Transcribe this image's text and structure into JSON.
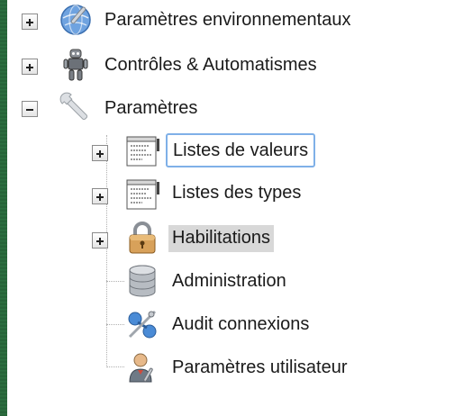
{
  "tree": {
    "root_items": [
      {
        "label": "Paramètres environnementaux",
        "expander": "+",
        "icon": "globe-wrench-icon"
      },
      {
        "label": "Contrôles & Automatismes",
        "expander": "+",
        "icon": "robot-icon"
      },
      {
        "label": "Paramètres",
        "expander": "−",
        "icon": "wrench-icon"
      }
    ],
    "children": [
      {
        "label": "Listes de valeurs",
        "expander": "+",
        "icon": "list-document-icon",
        "state": "selected"
      },
      {
        "label": "Listes des types",
        "expander": "+",
        "icon": "list-document-icon",
        "state": "normal"
      },
      {
        "label": "Habilitations",
        "expander": "+",
        "icon": "padlock-icon",
        "state": "highlighted"
      },
      {
        "label": "Administration",
        "expander": "",
        "icon": "database-icon",
        "state": "normal"
      },
      {
        "label": "Audit connexions",
        "expander": "",
        "icon": "network-audit-icon",
        "state": "normal"
      },
      {
        "label": "Paramètres utilisateur",
        "expander": "",
        "icon": "user-settings-icon",
        "state": "normal"
      }
    ]
  },
  "colors": {
    "left_edge": "#2a6a3c",
    "selection_border": "#7fb0e8",
    "highlight_bg": "#d8d8d8",
    "text": "#1a1a1a"
  }
}
